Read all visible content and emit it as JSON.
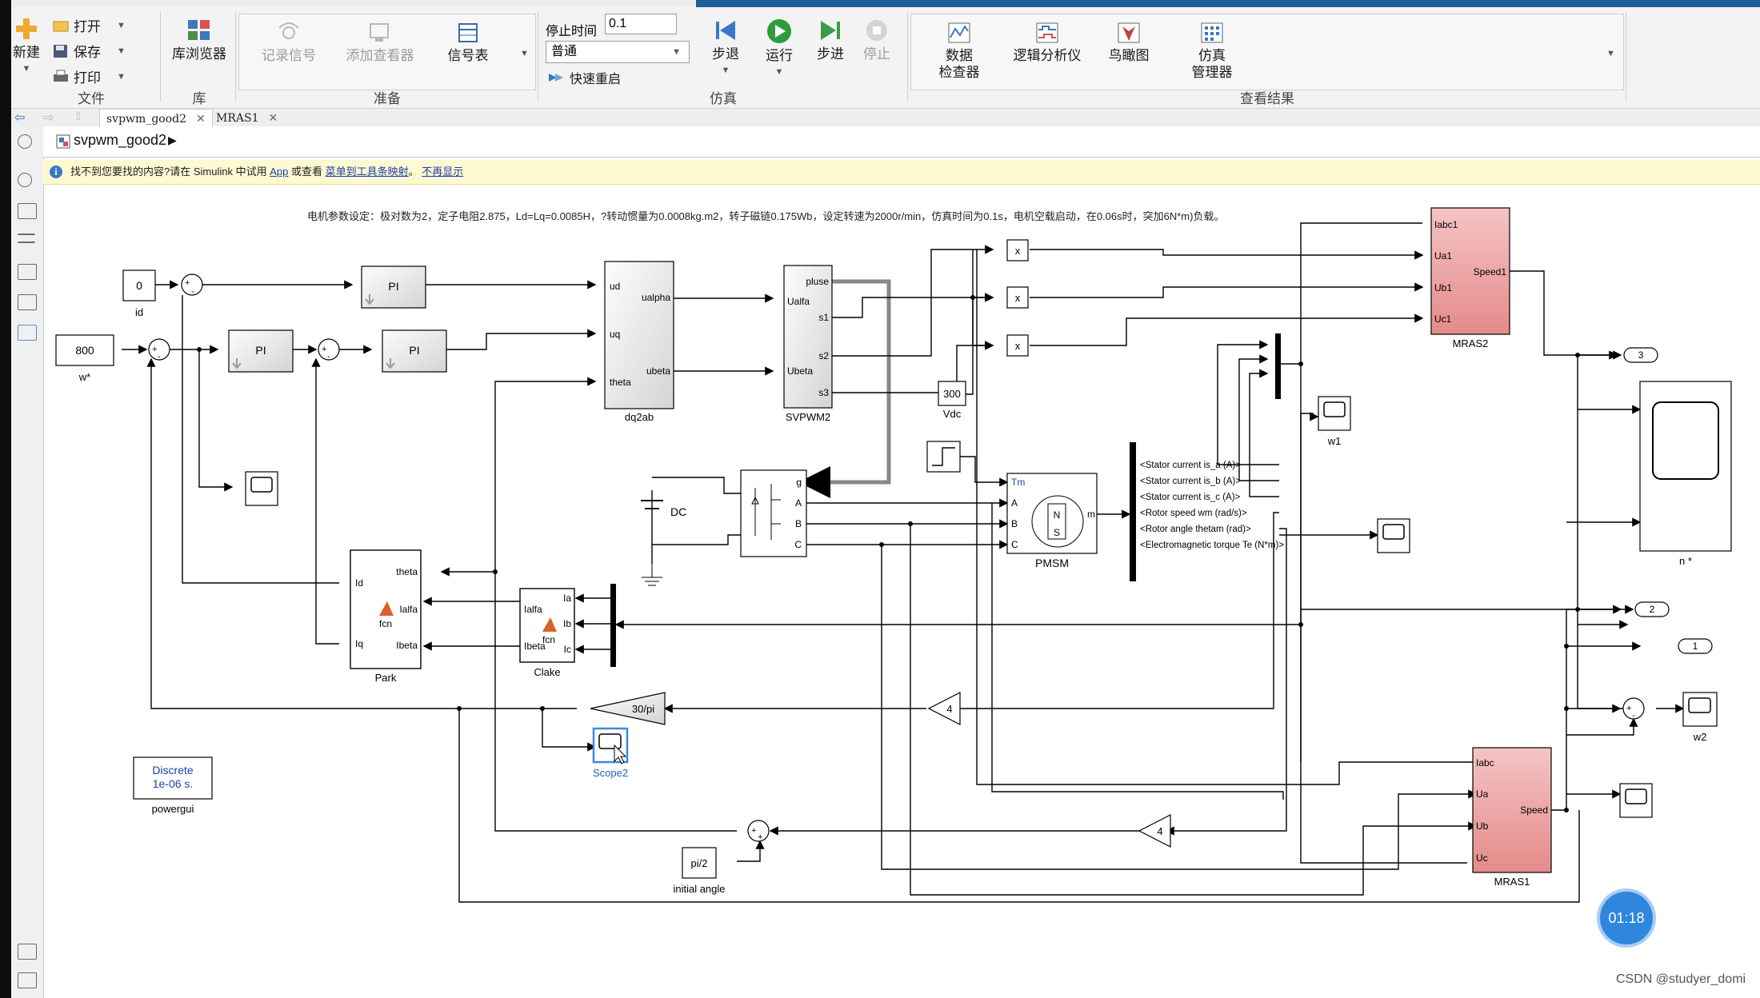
{
  "ribbon": {
    "file": {
      "new": "新建",
      "open": "打开",
      "save": "保存",
      "print": "打印",
      "section": "文件"
    },
    "library": {
      "browser": "库浏览器",
      "section": "库"
    },
    "prepare": {
      "log_signal": "记录信号",
      "add_viewer": "添加查看器",
      "signal_table": "信号表",
      "section": "准备"
    },
    "simulation": {
      "stop_time_label": "停止时间",
      "stop_time_value": "0.1",
      "mode": "普通",
      "fast_restart": "快速重启",
      "step_back": "步退",
      "run": "运行",
      "step_forward": "步进",
      "stop": "停止",
      "section": "仿真"
    },
    "review": {
      "data_inspector_1": "数据",
      "data_inspector_2": "检查器",
      "logic_analyzer": "逻辑分析仪",
      "birds_eye": "鸟瞰图",
      "sim_manager_1": "仿真",
      "sim_manager_2": "管理器",
      "section": "查看结果"
    }
  },
  "tabs": [
    {
      "label": "svpwm_good2",
      "active": true
    },
    {
      "label": "MRAS1",
      "active": false
    }
  ],
  "breadcrumb": {
    "model": "svpwm_good2"
  },
  "infobar": {
    "text_1": "找不到您要找的内容?请在 Simulink 中试用",
    "link_app": "App",
    "text_2": "或查看",
    "link_map": "菜单到工具条映射",
    "text_3": "。",
    "link_dismiss": "不再显示"
  },
  "annotation": "电机参数设定：极对数为2，定子电阻2.875，Ld=Lq=0.0085H，?转动惯量为0.0008kg.m2，转子磁链0.175Wb，设定转速为2000r/min，仿真时间为0.1s，电机空载启动，在0.06s时，突加6N*m)负载。",
  "blocks": {
    "const_id": {
      "value": "0",
      "label": "id"
    },
    "const_w": {
      "value": "800",
      "label": "w*"
    },
    "pi": "PI",
    "dq2ab": {
      "label": "dq2ab",
      "in": [
        "ud",
        "uq",
        "theta"
      ],
      "out": [
        "ualpha",
        "ubeta"
      ]
    },
    "svpwm": {
      "label": "SVPWM2",
      "in": [
        "Ualfa",
        "Ubeta"
      ],
      "out": [
        "pluse",
        "s1",
        "s2",
        "s3"
      ]
    },
    "mult": "x",
    "vdc": {
      "value": "300",
      "label": "Vdc"
    },
    "mras2": {
      "label": "MRAS2",
      "in": [
        "Iabc1",
        "Ua1",
        "Ub1",
        "Uc1"
      ],
      "out": "Speed1"
    },
    "mras1": {
      "label": "MRAS1",
      "in": [
        "Iabc",
        "Ua",
        "Ub",
        "Uc"
      ],
      "out": "Speed"
    },
    "dc": "DC",
    "inverter_ports": [
      "g",
      "A",
      "B",
      "C"
    ],
    "pmsm": {
      "label": "PMSM",
      "ports": [
        "Tm",
        "A",
        "B",
        "C"
      ],
      "out": "m",
      "n": "N",
      "s": "S"
    },
    "bus_labels": [
      "<Stator current is_a (A)>",
      "<Stator current is_b (A)>",
      "<Stator current is_c (A)>",
      "<Rotor speed wm (rad/s)>",
      "<Rotor angle thetam (rad)>",
      "<Electromagnetic torque Te (N*m)>"
    ],
    "park": {
      "label": "Park",
      "in": [
        "Id",
        "Iq"
      ],
      "out": [
        "theta",
        "Ialfa",
        "Ibeta"
      ],
      "fcn": "fcn"
    },
    "clake": {
      "label": "Clake",
      "in": [
        "Ialfa",
        "Ibeta"
      ],
      "out": [
        "Ia",
        "Ib",
        "Ic"
      ],
      "fcn": "fcn"
    },
    "gain_30pi": "30/pi",
    "gain_4": "4",
    "scope2": "Scope2",
    "scope_w1": "w1",
    "scope_n": "n *",
    "scope_w2": "w2",
    "outports": [
      "3",
      "2",
      "1"
    ],
    "powergui": {
      "line1": "Discrete",
      "line2": "1e-06 s.",
      "label": "powergui"
    },
    "pi2": {
      "value": "pi/2",
      "label": "initial angle"
    }
  },
  "timer": "01:18",
  "watermark": "CSDN @studyer_domi"
}
